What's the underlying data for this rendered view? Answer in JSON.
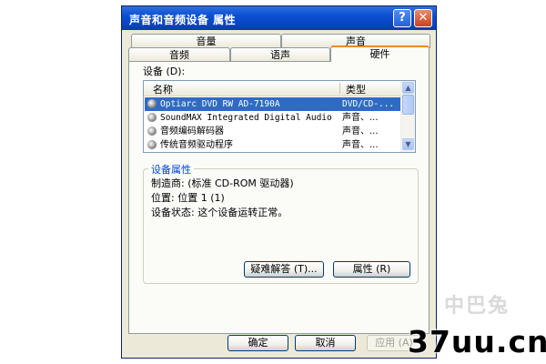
{
  "window": {
    "title": "声音和音频设备 属性",
    "help_glyph": "?",
    "close_glyph": "✕"
  },
  "tabs": {
    "row_back": [
      "音量",
      "声音"
    ],
    "row_front": [
      "音频",
      "语声",
      "硬件"
    ],
    "active": "硬件"
  },
  "devices": {
    "label": "设备 (D):",
    "columns": [
      "名称",
      "类型"
    ],
    "rows": [
      {
        "name": "Optiarc DVD RW AD-7190A",
        "type": "DVD/CD-...",
        "selected": true,
        "icon": "cdrom-icon"
      },
      {
        "name": "SoundMAX Integrated Digital Audio",
        "type": "声音、...",
        "selected": false,
        "icon": "audio-device-icon"
      },
      {
        "name": "音频编码解码器",
        "type": "声音、...",
        "selected": false,
        "icon": "audio-device-icon"
      },
      {
        "name": "传统音频驱动程序",
        "type": "声音、...",
        "selected": false,
        "icon": "audio-device-icon"
      }
    ]
  },
  "properties": {
    "title": "设备属性",
    "manufacturer": "制造商: (标准 CD-ROM 驱动器)",
    "location": "位置: 位置 1 (1)",
    "status": "设备状态: 这个设备运转正常。"
  },
  "buttons": {
    "troubleshoot": "疑难解答 (T)...",
    "properties": "属性 (R)",
    "ok": "确定",
    "cancel": "取消",
    "apply": "应用 (A)"
  },
  "watermark": {
    "text": "37uu.cn",
    "faint": "中巴兔"
  },
  "colors": {
    "titlebar": "#0a4fd1",
    "selection": "#316ac5",
    "group_title": "#0046d5",
    "tab_highlight": "#e68b2c"
  }
}
